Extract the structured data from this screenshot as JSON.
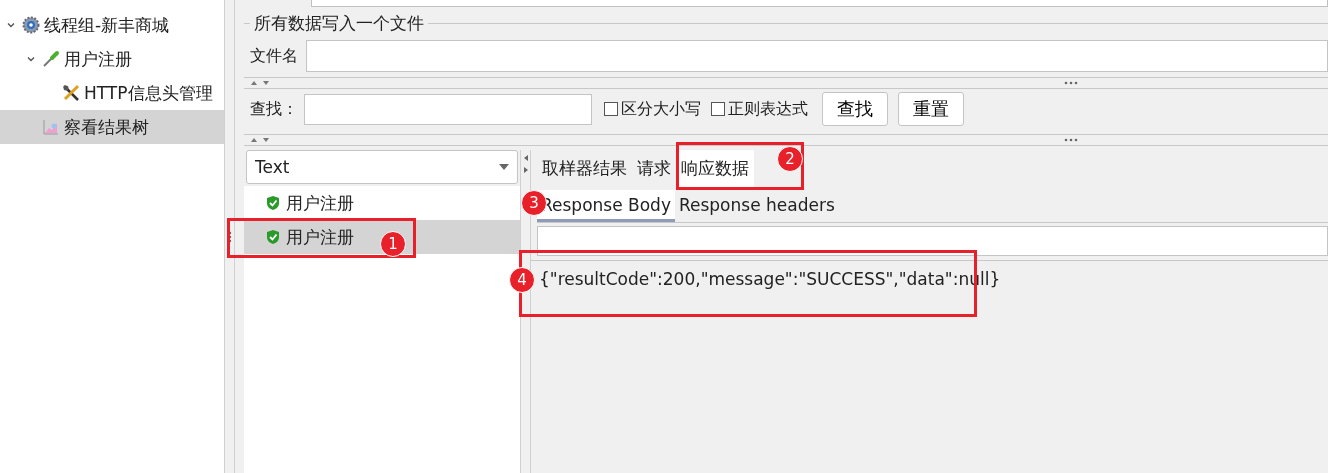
{
  "tree": [
    {
      "label": "线程组-新丰商城",
      "expanded": true,
      "selected": false,
      "children": [
        {
          "label": "用户注册",
          "expanded": true,
          "selected": false,
          "children": [
            {
              "label": "HTTP信息头管理",
              "selected": false
            }
          ]
        },
        {
          "label": "察看结果树",
          "selected": true
        }
      ]
    }
  ],
  "write_all": {
    "legend": "所有数据写入一个文件",
    "filename_label": "文件名"
  },
  "search": {
    "label": "查找：",
    "options": [
      {
        "label": "区分大小写",
        "checked": false
      },
      {
        "label": "正则表达式",
        "checked": false
      }
    ],
    "buttons": [
      "查找",
      "重置"
    ]
  },
  "renderer": {
    "value": "Text"
  },
  "results": [
    {
      "label": "用户注册",
      "selected": false
    },
    {
      "label": "用户注册",
      "selected": true
    }
  ],
  "tabs": [
    {
      "label": "取样器结果",
      "selected": false
    },
    {
      "label": "请求",
      "selected": false
    },
    {
      "label": "响应数据",
      "selected": true
    }
  ],
  "subtabs": [
    {
      "label": "Response Body",
      "selected": true
    },
    {
      "label": "Response headers",
      "selected": false
    }
  ],
  "response_text": "{\"resultCode\":200,\"message\":\"SUCCESS\",\"data\":null}",
  "annotations": [
    {
      "number": "1"
    },
    {
      "number": "2"
    },
    {
      "number": "3"
    },
    {
      "number": "4"
    }
  ]
}
